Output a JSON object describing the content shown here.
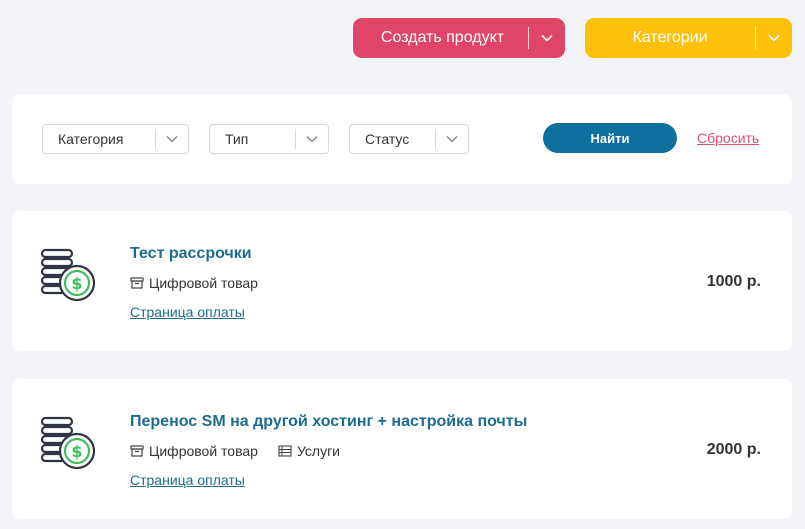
{
  "actions": {
    "create_label": "Создать продукт",
    "categories_label": "Категории"
  },
  "filters": {
    "category": "Категория",
    "type": "Тип",
    "status": "Статус",
    "find_label": "Найти",
    "reset_label": "Сбросить"
  },
  "products": [
    {
      "title": "Тест рассрочки",
      "tags": [
        "Цифровой товар"
      ],
      "pay_link": "Страница оплаты",
      "price": "1000 р."
    },
    {
      "title": "Перенос SM на другой хостинг + настройка почты",
      "tags": [
        "Цифровой товар",
        "Услуги"
      ],
      "pay_link": "Страница оплаты",
      "price": "2000 р."
    }
  ],
  "colors": {
    "create": "#e04467",
    "categories": "#fdc10b",
    "find": "#0f6f9e",
    "link": "#1d6b8f",
    "reset": "#d8506a"
  },
  "icons": {
    "product": "coins-dollar-icon",
    "digital": "box-icon",
    "services": "list-icon",
    "caret": "chevron-down-icon"
  }
}
